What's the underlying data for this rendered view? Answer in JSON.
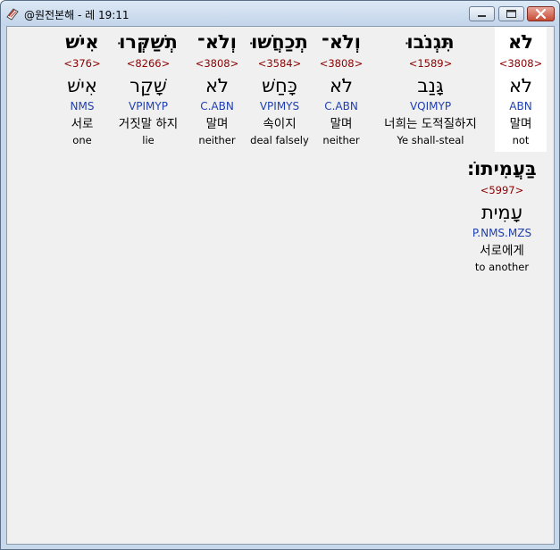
{
  "window": {
    "title": "@원전본해 - 레 19:11",
    "icon": "bible-app-icon"
  },
  "words": [
    {
      "hebrew": "לֹא",
      "strong": "<3808>",
      "lexeme": "לֹא",
      "morph": "ABN",
      "korean": "말며",
      "english": "not",
      "highlighted": true
    },
    {
      "hebrew": "תִּגְנֹבוּ",
      "strong": "<1589>",
      "lexeme": "גָּנַב",
      "morph": "VQIMYP",
      "korean": "너희는 도적질하지",
      "english": "Ye shall-steal",
      "highlighted": false
    },
    {
      "hebrew": "וְלֹא־",
      "strong": "<3808>",
      "lexeme": "לֹא",
      "morph": "C.ABN",
      "korean": "말며",
      "english": "neither",
      "highlighted": false
    },
    {
      "hebrew": "תְכַחֲשׁוּ",
      "strong": "<3584>",
      "lexeme": "כָּחַשׁ",
      "morph": "VPIMYS",
      "korean": "속이지",
      "english": "deal falsely",
      "highlighted": false
    },
    {
      "hebrew": "וְלֹא־",
      "strong": "<3808>",
      "lexeme": "לֹא",
      "morph": "C.ABN",
      "korean": "말며",
      "english": "neither",
      "highlighted": false
    },
    {
      "hebrew": "תְשַׁקְּרוּ",
      "strong": "<8266>",
      "lexeme": "שָׁקַר",
      "morph": "VPIMYP",
      "korean": "거짓말 하지",
      "english": "lie",
      "highlighted": false
    },
    {
      "hebrew": "אִישׁ",
      "strong": "<376>",
      "lexeme": "אִישׁ",
      "morph": "NMS",
      "korean": "서로",
      "english": "one",
      "highlighted": false
    },
    {
      "hebrew": "בַּעֲמִיתוֹ׃",
      "strong": "<5997>",
      "lexeme": "עָמִית",
      "morph": "P.NMS.MZS",
      "korean": "서로에게",
      "english": "to another",
      "highlighted": false
    }
  ]
}
